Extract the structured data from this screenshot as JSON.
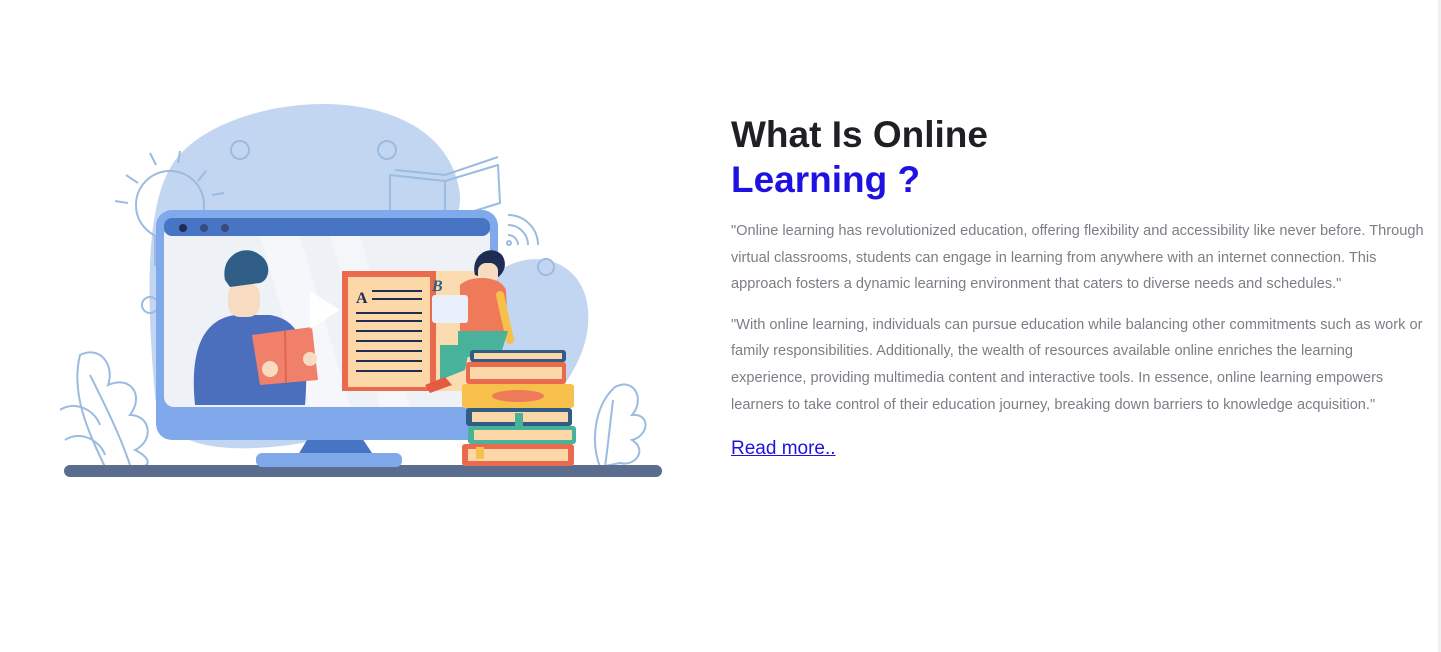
{
  "hero": {
    "title_line1": "What Is Online",
    "title_line2": "Learning ?",
    "paragraph1": "\"Online learning has revolutionized education, offering flexibility and accessibility like never before. Through virtual classrooms, students can engage in learning from anywhere with an internet connection. This approach fosters a dynamic learning environment that caters to diverse needs and schedules.\"",
    "paragraph2": "\"With online learning, individuals can pursue education while balancing other commitments such as work or family responsibilities. Additionally, the wealth of resources available online enriches the learning experience, providing multimedia content and interactive tools. In essence, online learning empowers learners to take control of their education journey, breaking down barriers to knowledge acquisition.\"",
    "read_more_label": "Read more..",
    "illustration": {
      "name": "online-learning-illustration",
      "book_letter_a": "A",
      "book_letter_b": "B"
    }
  },
  "colors": {
    "heading": "#1f1f24",
    "accent": "#1f12e0",
    "body_text": "#7d7d86",
    "blob": "#c2d6f1",
    "monitor_frame": "#7fa9ea",
    "screen_bar": "#4874c4"
  }
}
